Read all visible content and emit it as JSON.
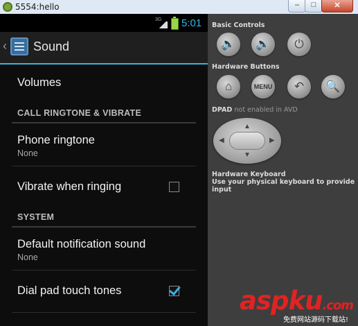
{
  "window": {
    "title": "5554:hello",
    "buttons": {
      "minimize": "–",
      "maximize": "□",
      "close": "✕"
    }
  },
  "phone": {
    "status": {
      "network": "3G",
      "time": "5:01"
    },
    "action_bar": {
      "up": "‹",
      "title": "Sound"
    },
    "list": [
      {
        "kind": "item",
        "title": "Volumes"
      },
      {
        "kind": "category",
        "title": "CALL RINGTONE & VIBRATE"
      },
      {
        "kind": "item",
        "title": "Phone ringtone",
        "summary": "None"
      },
      {
        "kind": "check",
        "title": "Vibrate when ringing",
        "checked": false
      },
      {
        "kind": "category",
        "title": "SYSTEM"
      },
      {
        "kind": "item",
        "title": "Default notification sound",
        "summary": "None"
      },
      {
        "kind": "check",
        "title": "Dial pad touch tones",
        "checked": true
      }
    ]
  },
  "panel": {
    "basic_controls": "Basic Controls",
    "hardware_buttons": "Hardware Buttons",
    "dpad_title": "DPAD",
    "dpad_note": "not enabled in AVD",
    "hardware_keyboard": "Hardware Keyboard",
    "keyboard_note": "Use your physical keyboard to provide input",
    "buttons": {
      "volume_down": "🔈",
      "volume_up": "🔊",
      "power": "⏻",
      "home": "⌂",
      "menu": "MENU",
      "back": "↶",
      "search": "🔍"
    },
    "dpad_arrows": {
      "up": "▲",
      "down": "▼",
      "left": "◀",
      "right": "▶"
    }
  },
  "watermark": {
    "main": "aspku",
    "suffix": ".com",
    "sub": "免费网站源码下载站!"
  },
  "colors": {
    "accent": "#33b5e5",
    "panel_bg": "#3e3e3e",
    "phone_bg": "#0d0d0d",
    "watermark": "#e02323"
  }
}
